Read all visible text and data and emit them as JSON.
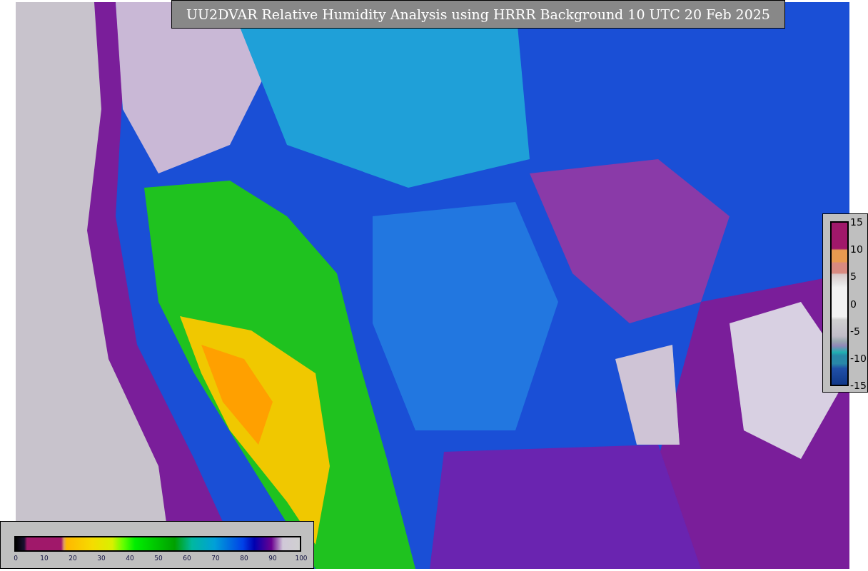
{
  "title": "UU2DVAR Relative Humidity Analysis using HRRR Background 10 UTC 20 Feb 2025",
  "humidity_scale": {
    "ticks": [
      "0",
      "10",
      "20",
      "30",
      "40",
      "50",
      "60",
      "70",
      "80",
      "90",
      "100"
    ]
  },
  "difference_scale": {
    "ticks": [
      "15",
      "10",
      "5",
      "0",
      "-5",
      "-10",
      "-15"
    ]
  }
}
